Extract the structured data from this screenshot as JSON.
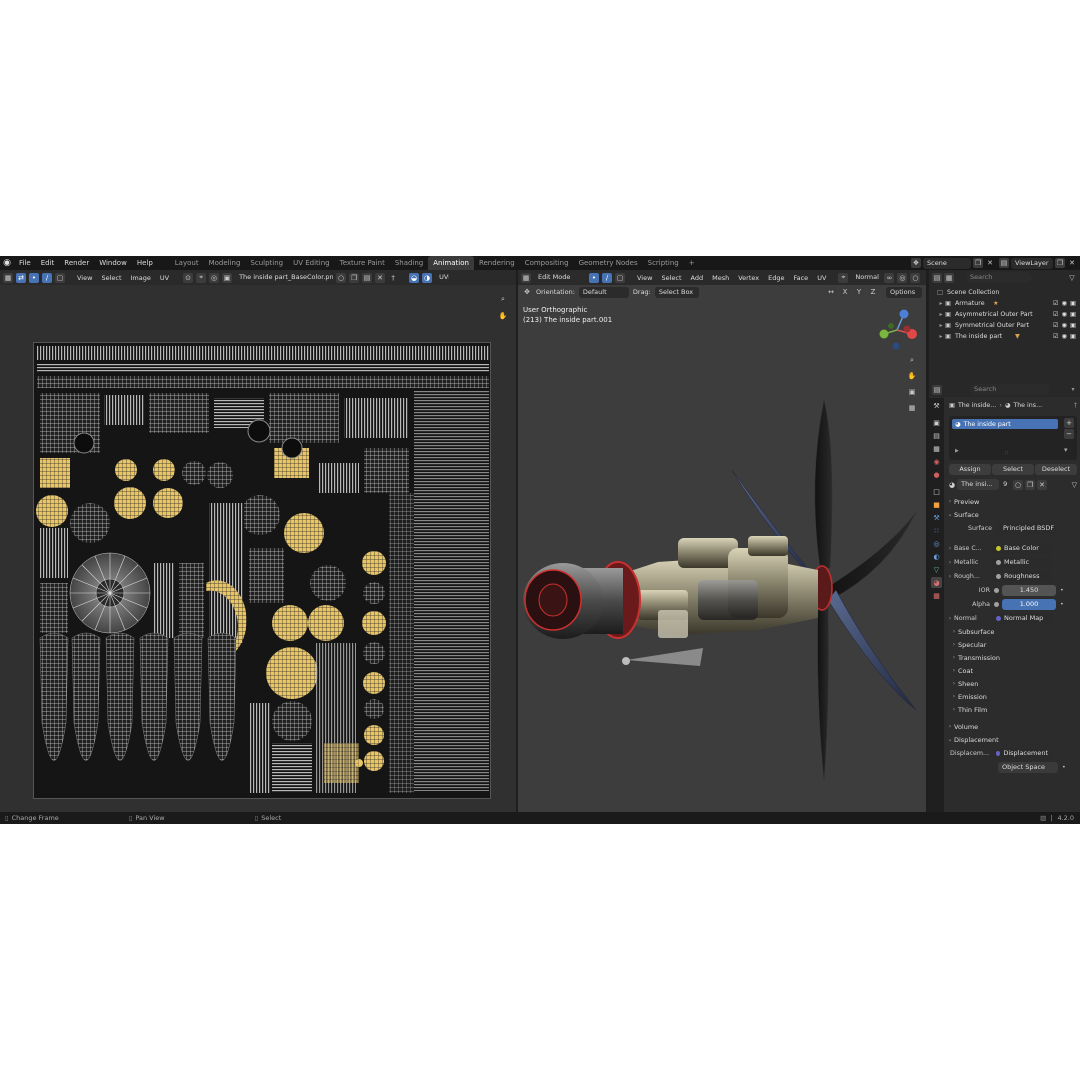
{
  "topbar": {
    "menus": [
      "File",
      "Edit",
      "Render",
      "Window",
      "Help"
    ],
    "workspaces": [
      "Layout",
      "Modeling",
      "Sculpting",
      "UV Editing",
      "Texture Paint",
      "Shading",
      "Animation",
      "Rendering",
      "Compositing",
      "Geometry Nodes",
      "Scripting"
    ],
    "active_workspace": "Animation",
    "add_tab": "+",
    "scene": "Scene",
    "view_layer": "ViewLayer"
  },
  "uv_editor": {
    "menus": [
      "View",
      "Select",
      "Image",
      "UV"
    ],
    "image_name": "The inside part_BaseColor.png",
    "uv_map": "UVM"
  },
  "viewport": {
    "mode": "Edit Mode",
    "menus": [
      "View",
      "Select",
      "Add",
      "Mesh",
      "Vertex",
      "Edge",
      "Face",
      "UV"
    ],
    "shading": "Normal",
    "orientation_label": "Orientation:",
    "orientation_value": "Default",
    "drag_label": "Drag:",
    "drag_value": "Select Box",
    "axes": [
      "X",
      "Y",
      "Z"
    ],
    "options": "Options",
    "view_name": "User Orthographic",
    "object_info": "(213) The inside part.001"
  },
  "outliner": {
    "search_placeholder": "Search",
    "root": "Scene Collection",
    "items": [
      "Armature",
      "Asymmetrical Outer Part",
      "Symmetrical Outer Part",
      "The inside part"
    ]
  },
  "properties": {
    "search_placeholder": "Search",
    "breadcrumb_object": "The inside...",
    "breadcrumb_material": "The ins...",
    "material_slot": "The inside part",
    "assign": "Assign",
    "select": "Select",
    "deselect": "Deselect",
    "material_name": "The insi...",
    "material_users": "9",
    "sections": {
      "preview": "Preview",
      "surface": "Surface",
      "volume": "Volume",
      "displacement": "Displacement"
    },
    "surface_label": "Surface",
    "surface_shader": "Principled BSDF",
    "rows": [
      {
        "label": "Base C...",
        "value": "Base Color"
      },
      {
        "label": "Metallic",
        "value": "Metallic"
      },
      {
        "label": "Rough...",
        "value": "Roughness"
      },
      {
        "label": "IOR",
        "value": "1.450"
      },
      {
        "label": "Alpha",
        "value": "1.000"
      },
      {
        "label": "Normal",
        "value": "Normal Map"
      }
    ],
    "subpanels": [
      "Subsurface",
      "Specular",
      "Transmission",
      "Coat",
      "Sheen",
      "Emission",
      "Thin Film"
    ],
    "displacement_label": "Displacem...",
    "displacement_value": "Displacement",
    "space": "Object Space"
  },
  "statusbar": {
    "items": [
      "Change Frame",
      "Pan View",
      "Select"
    ],
    "version": "4.2.0"
  },
  "colors": {
    "accent": "#4772b3",
    "active_field": "#4772b3",
    "uv_yellow": "#e8c565",
    "socket_yellow": "#c7c729",
    "socket_gray": "#a1a1a1",
    "socket_purple": "#6363c7"
  }
}
